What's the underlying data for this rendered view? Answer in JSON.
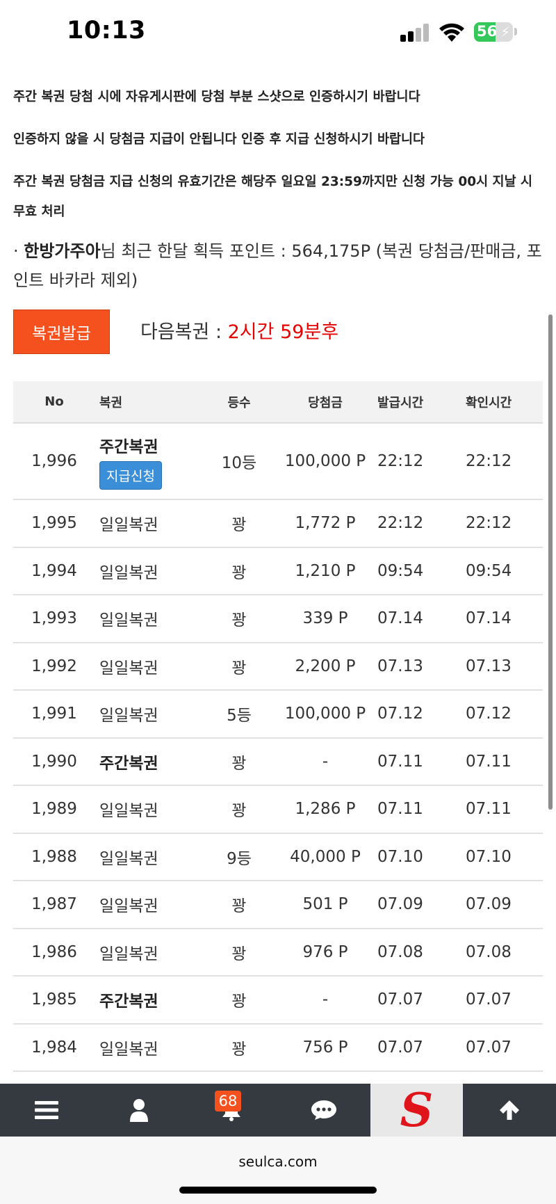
{
  "status_bar": {
    "time": "10:13",
    "battery_level": "56",
    "battery_percent": 56,
    "battery_color": "#34c759"
  },
  "notices": [
    "주간 복권 당첨 시에 자유게시판에 당첨 부분 스샷으로 인증하시기 바랍니다",
    "인증하지 않을 시 당첨금 지급이 안됩니다 인증 후 지급 신청하시기 바랍니다",
    "주간 복권 당첨금 지급 신청의 유효기간은 해당주 일요일 23:59까지만 신청 가능 00시 지날 시 무효 처리"
  ],
  "points": {
    "prefix": "· ",
    "nickname": "한방가주아",
    "text": "님 최근 한달 획득 포인트 : 564,175P (복권 당첨금/판매금, 포인트 바카라 제외)"
  },
  "issue_button_label": "복권발급",
  "next_lotto": {
    "label": "다음복권 : ",
    "value": "2시간 59분후"
  },
  "table": {
    "headers": [
      "No",
      "복권",
      "등수",
      "당첨금",
      "발급시간",
      "확인시간"
    ],
    "claim_label": "지급신청",
    "rows": [
      {
        "no": "1,996",
        "lotto": "주간복권",
        "weekly": true,
        "claim": true,
        "rank": "10등",
        "prize": "100,000 P",
        "issued": "22:12",
        "checked": "22:12"
      },
      {
        "no": "1,995",
        "lotto": "일일복권",
        "weekly": false,
        "claim": false,
        "rank": "꽝",
        "prize": "1,772 P",
        "issued": "22:12",
        "checked": "22:12"
      },
      {
        "no": "1,994",
        "lotto": "일일복권",
        "weekly": false,
        "claim": false,
        "rank": "꽝",
        "prize": "1,210 P",
        "issued": "09:54",
        "checked": "09:54"
      },
      {
        "no": "1,993",
        "lotto": "일일복권",
        "weekly": false,
        "claim": false,
        "rank": "꽝",
        "prize": "339 P",
        "issued": "07.14",
        "checked": "07.14"
      },
      {
        "no": "1,992",
        "lotto": "일일복권",
        "weekly": false,
        "claim": false,
        "rank": "꽝",
        "prize": "2,200 P",
        "issued": "07.13",
        "checked": "07.13"
      },
      {
        "no": "1,991",
        "lotto": "일일복권",
        "weekly": false,
        "claim": false,
        "rank": "5등",
        "prize": "100,000 P",
        "issued": "07.12",
        "checked": "07.12"
      },
      {
        "no": "1,990",
        "lotto": "주간복권",
        "weekly": true,
        "claim": false,
        "rank": "꽝",
        "prize": "-",
        "issued": "07.11",
        "checked": "07.11"
      },
      {
        "no": "1,989",
        "lotto": "일일복권",
        "weekly": false,
        "claim": false,
        "rank": "꽝",
        "prize": "1,286 P",
        "issued": "07.11",
        "checked": "07.11"
      },
      {
        "no": "1,988",
        "lotto": "일일복권",
        "weekly": false,
        "claim": false,
        "rank": "9등",
        "prize": "40,000 P",
        "issued": "07.10",
        "checked": "07.10"
      },
      {
        "no": "1,987",
        "lotto": "일일복권",
        "weekly": false,
        "claim": false,
        "rank": "꽝",
        "prize": "501 P",
        "issued": "07.09",
        "checked": "07.09"
      },
      {
        "no": "1,986",
        "lotto": "일일복권",
        "weekly": false,
        "claim": false,
        "rank": "꽝",
        "prize": "976 P",
        "issued": "07.08",
        "checked": "07.08"
      },
      {
        "no": "1,985",
        "lotto": "주간복권",
        "weekly": true,
        "claim": false,
        "rank": "꽝",
        "prize": "-",
        "issued": "07.07",
        "checked": "07.07"
      },
      {
        "no": "1,984",
        "lotto": "일일복권",
        "weekly": false,
        "claim": false,
        "rank": "꽝",
        "prize": "756 P",
        "issued": "07.07",
        "checked": "07.07"
      }
    ]
  },
  "bottom_nav": {
    "items": [
      "menu-icon",
      "user-icon",
      "bell-icon",
      "chat-icon",
      "site-logo",
      "arrow-up-icon"
    ],
    "notification_count": "68",
    "logo_letter": "S"
  },
  "browser": {
    "url": "seulca.com"
  },
  "colors": {
    "accent_orange": "#f4511e",
    "claim_blue": "#3b8fd8",
    "countdown_red": "#e60000",
    "nav_bg": "#343a40",
    "logo_red": "#e0141b"
  }
}
